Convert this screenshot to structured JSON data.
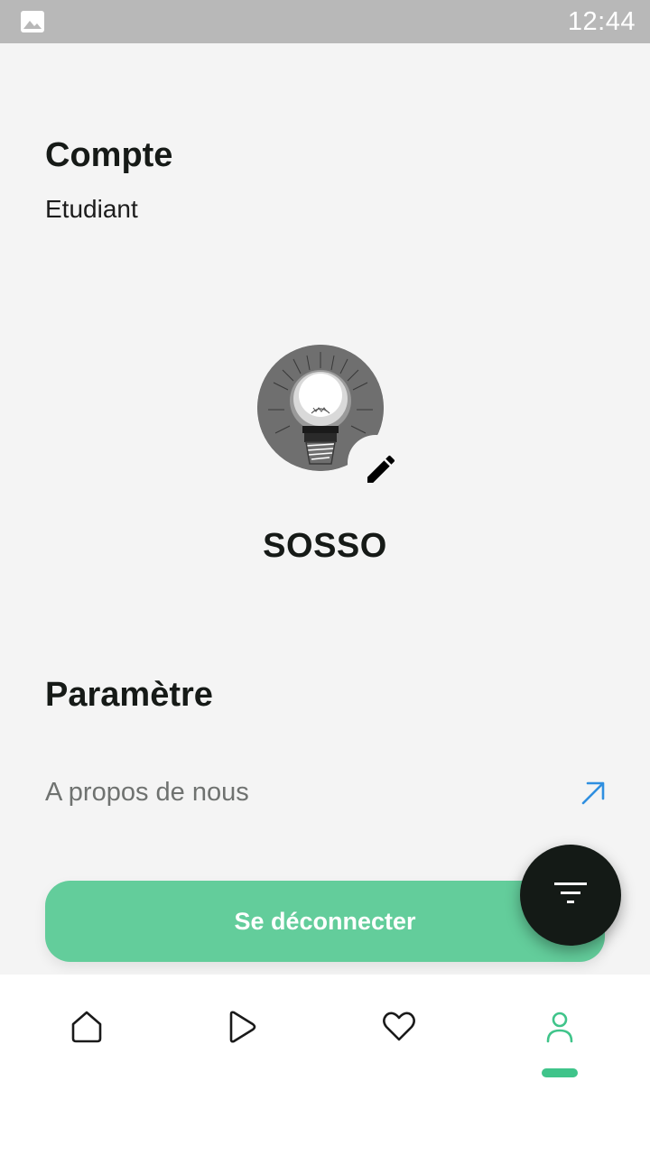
{
  "status_bar": {
    "time": "12:44",
    "left_icon": "image-icon"
  },
  "account": {
    "title": "Compte",
    "role": "Etudiant"
  },
  "profile": {
    "avatar_icon": "lightbulb-icon",
    "edit_icon": "pencil-icon",
    "username": "SOSSO"
  },
  "settings": {
    "title": "Paramètre",
    "about_label": "A propos de nous",
    "about_icon": "arrow-up-right-icon"
  },
  "actions": {
    "logout_label": "Se déconnecter",
    "filter_icon": "filter-icon"
  },
  "bottom_nav": {
    "items": [
      {
        "icon": "home-icon",
        "active": false
      },
      {
        "icon": "play-icon",
        "active": false
      },
      {
        "icon": "heart-icon",
        "active": false
      },
      {
        "icon": "user-icon",
        "active": true
      }
    ]
  },
  "colors": {
    "accent": "#63cd9b",
    "active_nav": "#3fc48a",
    "link_arrow": "#2f8fe0",
    "fab_bg": "#141a16"
  }
}
